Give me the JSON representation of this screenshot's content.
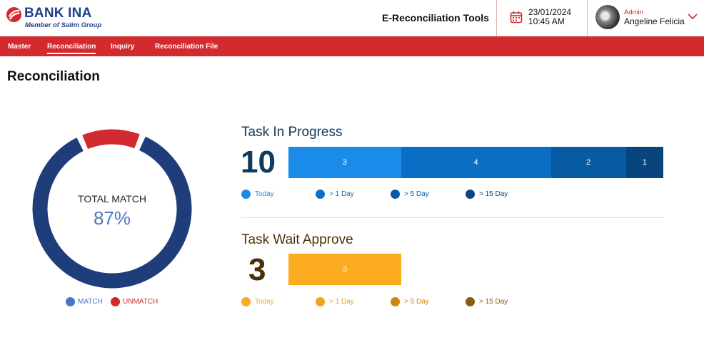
{
  "header": {
    "brand_name": "BANK INA",
    "brand_tagline": "Member of Salim Group",
    "app_title": "E-Reconciliation Tools",
    "date": "23/01/2024",
    "time": "10:45 AM",
    "user_role": "Admin",
    "user_name": "Angeline Felicia",
    "brand_color": "#1f3f8f",
    "accent_color": "#d32a2f"
  },
  "nav": {
    "items": [
      {
        "label": "Master",
        "active": false
      },
      {
        "label": "Reconciliation",
        "active": true
      },
      {
        "label": "Inquiry",
        "active": false
      },
      {
        "label": "Reconciliation File",
        "active": false
      }
    ]
  },
  "page": {
    "title": "Reconciliation"
  },
  "summary": {
    "label": "TOTAL MATCH",
    "value": "87%",
    "match_fraction": 0.87,
    "legend": [
      {
        "label": "MATCH",
        "color": "#4a76c4"
      },
      {
        "label": "UNMATCH",
        "color": "#d32a2f"
      }
    ],
    "match_ring_color": "#1f3d7a"
  },
  "task_in_progress": {
    "title": "Task In Progress",
    "count": "10",
    "title_color": "#0f3a5f",
    "segments": [
      {
        "value": 3,
        "label": "3",
        "color": "#1b8bea"
      },
      {
        "value": 4,
        "label": "4",
        "color": "#0a6ec4"
      },
      {
        "value": 2,
        "label": "2",
        "color": "#075ba3"
      },
      {
        "value": 1,
        "label": "1",
        "color": "#07457c"
      }
    ],
    "legend": [
      {
        "label": "Today",
        "color": "#1b8bea"
      },
      {
        "label": "> 1 Day",
        "color": "#0a6ec4"
      },
      {
        "label": "> 5 Day",
        "color": "#075ba3"
      },
      {
        "label": "> 15 Day",
        "color": "#07457c"
      }
    ]
  },
  "task_wait_approve": {
    "title": "Task Wait Approve",
    "count": "3",
    "title_color": "#4a3008",
    "segments": [
      {
        "value": 3,
        "label": "3",
        "color": "#fbab1f"
      }
    ],
    "legend": [
      {
        "label": "Today",
        "color": "#fbab1f"
      },
      {
        "label": "> 1 Day",
        "color": "#f0a21b"
      },
      {
        "label": "> 5 Day",
        "color": "#c98a14"
      },
      {
        "label": "> 15 Day",
        "color": "#8a5c10"
      }
    ]
  }
}
